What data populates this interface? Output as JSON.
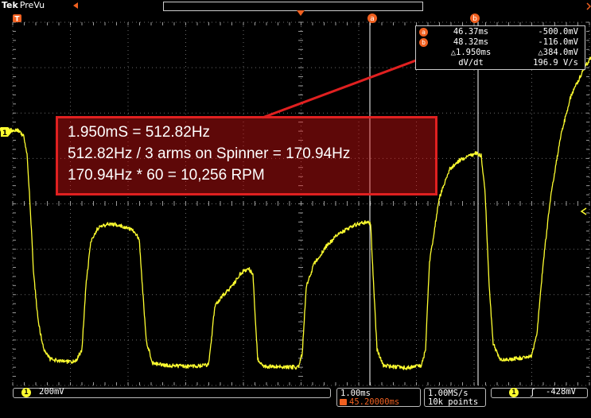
{
  "app": {
    "brand": "Tek",
    "mode": "PreVu"
  },
  "colors": {
    "trace": "#ffff30",
    "cursor": "#f06020",
    "annotation": "#e02020",
    "grid": "#6a6a6a"
  },
  "markers": {
    "trigger_position": "T",
    "channel1": "1",
    "cursor_a": "a",
    "cursor_b": "b"
  },
  "cursor_readout": {
    "row_a": {
      "badge": "a",
      "time": "46.37ms",
      "value": "-500.0mV"
    },
    "row_b": {
      "badge": "b",
      "time": "48.32ms",
      "value": "-116.0mV"
    },
    "delta": {
      "time": "△1.950ms",
      "value": "△384.0mV"
    },
    "slope": {
      "label": "dV/dt",
      "value": "196.9 V/s"
    }
  },
  "annotation": {
    "line1": "1.950mS = 512.82Hz",
    "line2": "512.82Hz / 3 arms on Spinner = 170.94Hz",
    "line3": "170.94Hz * 60 = 10,256 RPM"
  },
  "status_bar": {
    "channel": {
      "label": "1",
      "scale": "200mV"
    },
    "horizontal": {
      "scale": "1.00ms",
      "trigger_position": "45.20000ms"
    },
    "acquisition": {
      "rate": "1.00MS/s",
      "record": "10k points"
    },
    "trigger": {
      "channel": "1",
      "level": "-428mV"
    }
  }
}
